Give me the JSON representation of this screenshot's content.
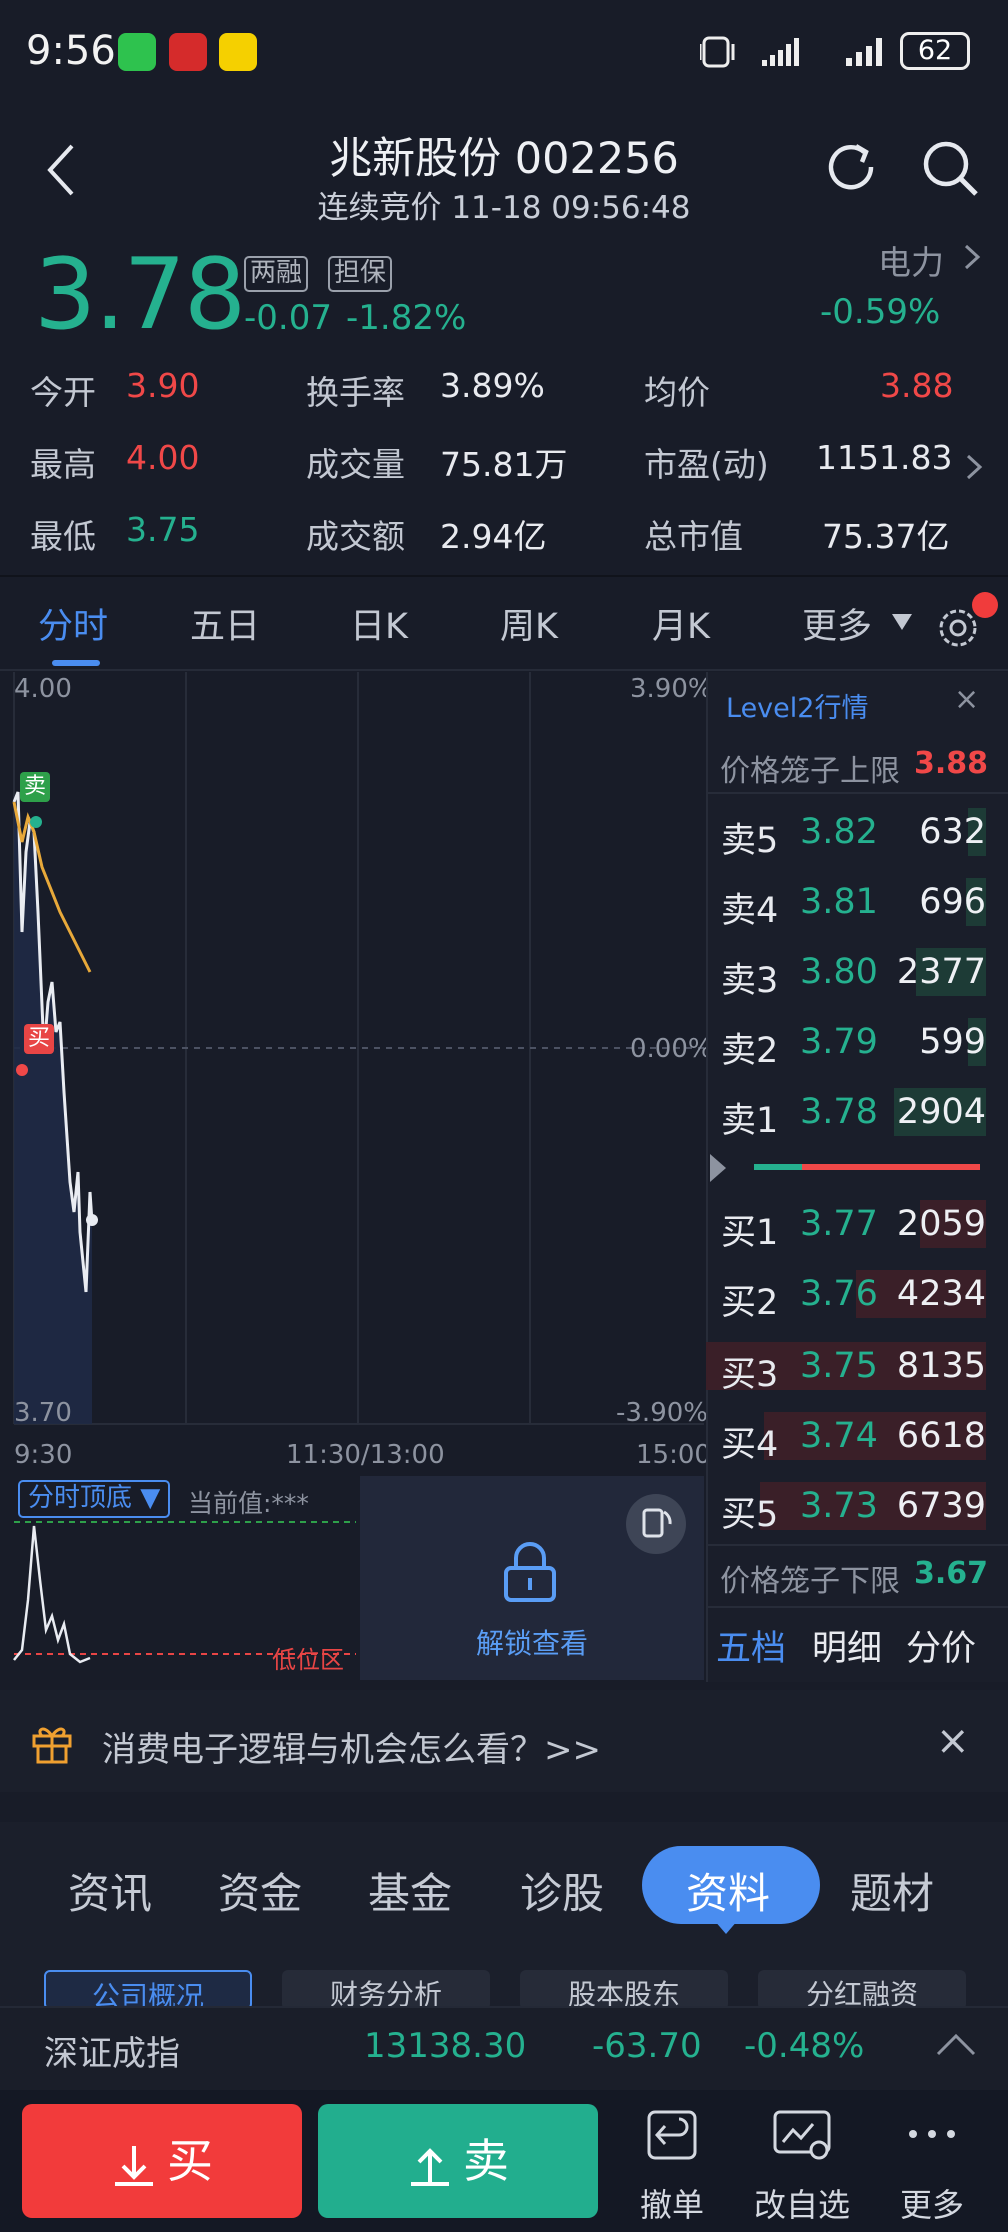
{
  "status_bar": {
    "time": "9:56",
    "battery": "62"
  },
  "header": {
    "title": "兆新股份 002256",
    "subtitle": "连续竞价 11-18 09:56:48"
  },
  "quote": {
    "price": "3.78",
    "tag_margin": "两融",
    "tag_collateral": "担保",
    "change": "-0.07",
    "change_pct": "-1.82%",
    "sector": "电力",
    "sector_change": "-0.59%"
  },
  "stats": {
    "open_label": "今开",
    "open": "3.90",
    "turnover_label": "换手率",
    "turnover": "3.89%",
    "avg_label": "均价",
    "avg": "3.88",
    "high_label": "最高",
    "high": "4.00",
    "volume_label": "成交量",
    "volume": "75.81万",
    "pe_label": "市盈(动)",
    "pe": "1151.83",
    "low_label": "最低",
    "low": "3.75",
    "amount_label": "成交额",
    "amount": "2.94亿",
    "mcap_label": "总市值",
    "mcap": "75.37亿"
  },
  "chart_tabs": [
    "分时",
    "五日",
    "日K",
    "周K",
    "月K",
    "更多"
  ],
  "chart": {
    "price_top": "4.00",
    "price_bottom": "3.70",
    "pct_top": "3.90%",
    "pct_mid": "0.00%",
    "pct_bottom": "-3.90%",
    "time_start": "9:30",
    "time_mid": "11:30/13:00",
    "time_end": "15:00",
    "sell_marker": "卖",
    "buy_marker": "买"
  },
  "indicator": {
    "name": "分时顶底",
    "current": "当前值:***",
    "low_zone": "低位区",
    "unlock": "解锁查看"
  },
  "level2": {
    "title": "Level2行情",
    "upper_label": "价格笼子上限",
    "upper": "3.88",
    "lower_label": "价格笼子下限",
    "lower": "3.67",
    "asks": [
      {
        "label": "卖5",
        "price": "3.82",
        "vol": "632"
      },
      {
        "label": "卖4",
        "price": "3.81",
        "vol": "696"
      },
      {
        "label": "卖3",
        "price": "3.80",
        "vol": "2377"
      },
      {
        "label": "卖2",
        "price": "3.79",
        "vol": "599"
      },
      {
        "label": "卖1",
        "price": "3.78",
        "vol": "2904"
      }
    ],
    "bids": [
      {
        "label": "买1",
        "price": "3.77",
        "vol": "2059"
      },
      {
        "label": "买2",
        "price": "3.76",
        "vol": "4234"
      },
      {
        "label": "买3",
        "price": "3.75",
        "vol": "8135"
      },
      {
        "label": "买4",
        "price": "3.74",
        "vol": "6618"
      },
      {
        "label": "买5",
        "price": "3.73",
        "vol": "6739"
      }
    ],
    "tabs": [
      "五档",
      "明细",
      "分价"
    ]
  },
  "promo": {
    "text": "消费电子逻辑与机会怎么看？>>"
  },
  "bottom_tabs": [
    "资讯",
    "资金",
    "基金",
    "诊股",
    "资料",
    "题材"
  ],
  "sub_tabs": [
    "公司概况",
    "财务分析",
    "股本股东",
    "分红融资"
  ],
  "index": {
    "name": "深证成指",
    "value": "13138.30",
    "change": "-63.70",
    "pct": "-0.48%"
  },
  "trade": {
    "buy": "买",
    "sell": "卖",
    "cancel": "撤单",
    "edit_watch": "改自选",
    "more": "更多"
  },
  "colors": {
    "up": "#f04848",
    "down": "#25b18f",
    "accent": "#4a8df0",
    "avg_line": "#e8a93a"
  }
}
